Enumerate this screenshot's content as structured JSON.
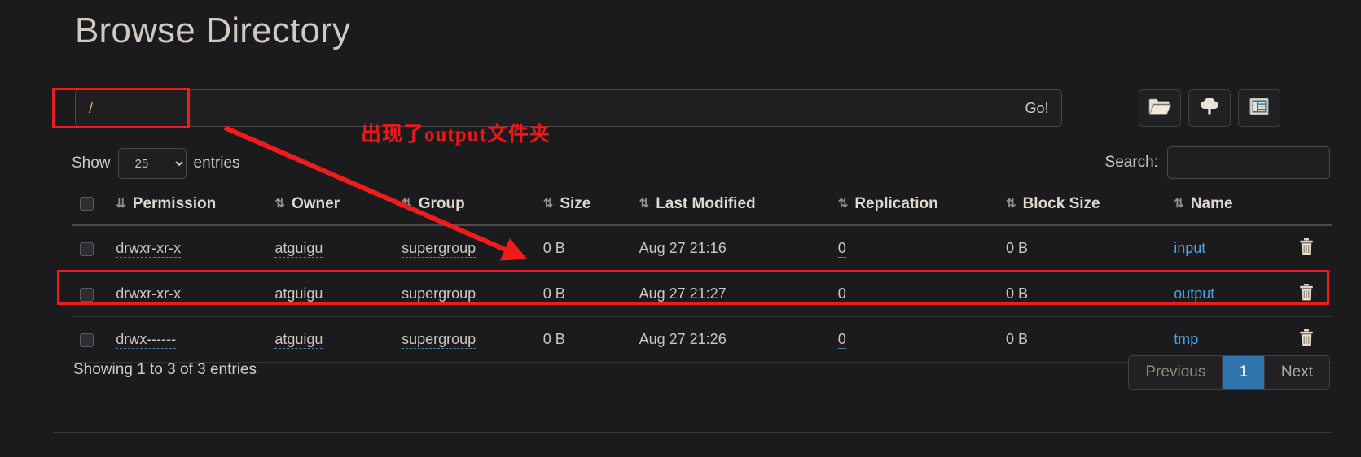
{
  "page": {
    "title": "Browse Directory"
  },
  "toolbar": {
    "path_value": "/",
    "path_placeholder": "",
    "go_label": "Go!",
    "icons": [
      {
        "name": "open-folder-icon",
        "tooltip": "Create Directory"
      },
      {
        "name": "cloud-upload-icon",
        "tooltip": "Upload Files"
      },
      {
        "name": "list-snapshot-icon",
        "tooltip": "Cut & Paste"
      }
    ]
  },
  "controls": {
    "show_label": "Show",
    "entries_label": "entries",
    "entries_value": "25",
    "entries_options": [
      "25",
      "50",
      "100"
    ],
    "search_label": "Search:",
    "search_value": "",
    "search_placeholder": ""
  },
  "table": {
    "columns": [
      {
        "key": "select",
        "label": ""
      },
      {
        "key": "permission",
        "label": "Permission"
      },
      {
        "key": "owner",
        "label": "Owner"
      },
      {
        "key": "group",
        "label": "Group"
      },
      {
        "key": "size",
        "label": "Size"
      },
      {
        "key": "modified",
        "label": "Last Modified"
      },
      {
        "key": "replication",
        "label": "Replication"
      },
      {
        "key": "blocksize",
        "label": "Block Size"
      },
      {
        "key": "name",
        "label": "Name"
      },
      {
        "key": "delete",
        "label": ""
      }
    ],
    "rows": [
      {
        "permission": "drwxr-xr-x",
        "owner": "atguigu",
        "group": "supergroup",
        "size": "0 B",
        "modified": "Aug 27 21:16",
        "replication": "0",
        "blocksize": "0 B",
        "name": "input",
        "highlighted": false
      },
      {
        "permission": "drwxr-xr-x",
        "owner": "atguigu",
        "group": "supergroup",
        "size": "0 B",
        "modified": "Aug 27 21:27",
        "replication": "0",
        "blocksize": "0 B",
        "name": "output",
        "highlighted": true
      },
      {
        "permission": "drwx------",
        "owner": "atguigu",
        "group": "supergroup",
        "size": "0 B",
        "modified": "Aug 27 21:26",
        "replication": "0",
        "blocksize": "0 B",
        "name": "tmp",
        "highlighted": false
      }
    ]
  },
  "footer": {
    "showing": "Showing 1 to 3 of 3 entries",
    "previous_label": "Previous",
    "page_label": "1",
    "next_label": "Next"
  },
  "annotations": {
    "note_text": "出现了output文件夹",
    "highlight_color": "#ee1c1c"
  }
}
